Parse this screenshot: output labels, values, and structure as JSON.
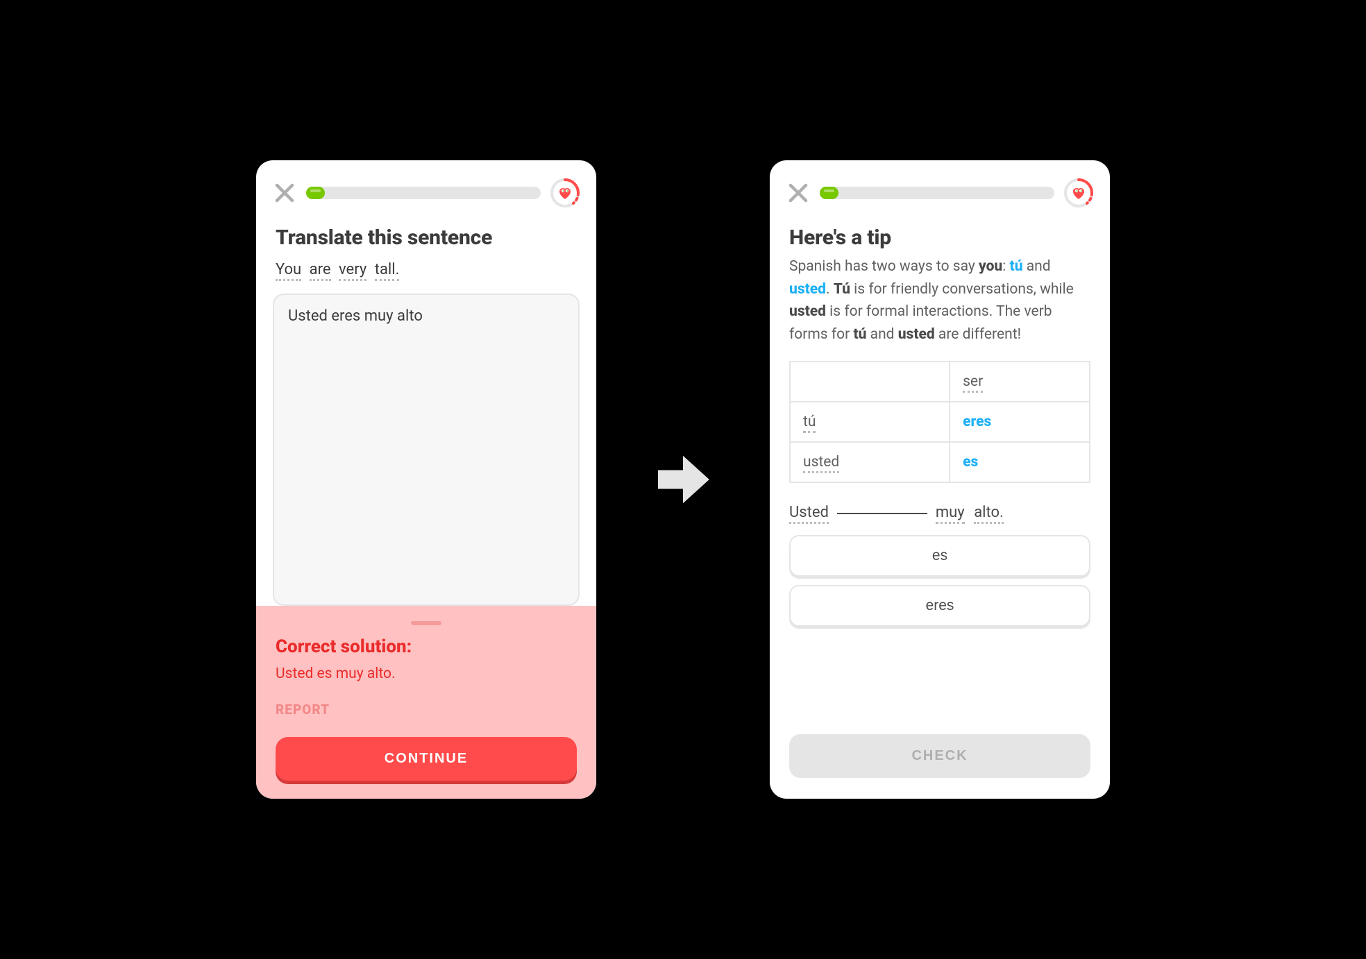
{
  "left": {
    "title": "Translate this sentence",
    "prompt_words": [
      "You",
      "are",
      "very",
      "tall."
    ],
    "user_answer": "Usted eres muy alto",
    "feedback_heading": "Correct solution:",
    "feedback_solution": "Usted es muy alto.",
    "report_label": "REPORT",
    "continue_label": "CONTINUE"
  },
  "right": {
    "title": "Here's a tip",
    "tip_p1a": "Spanish has two ways to say ",
    "tip_you": "you",
    "tip_colon": ": ",
    "tip_tu": "tú",
    "tip_and": " and ",
    "tip_usted": "usted",
    "tip_period": ". ",
    "tip_Tu_cap": "Tú",
    "tip_p2": " is for friendly conversations, while ",
    "tip_usted2": "usted",
    "tip_p3": " is for formal interactions. The verb forms for ",
    "tip_tu2": "tú",
    "tip_and2": " and ",
    "tip_usted3": "usted",
    "tip_p4": " are different!",
    "table": {
      "header_verb": "ser",
      "rows": [
        {
          "pronoun": "tú",
          "form": "eres"
        },
        {
          "pronoun": "usted",
          "form": "es"
        }
      ]
    },
    "fill_before": "Usted",
    "fill_after_words": [
      "muy",
      "alto."
    ],
    "options": [
      "es",
      "eres"
    ],
    "check_label": "CHECK"
  }
}
